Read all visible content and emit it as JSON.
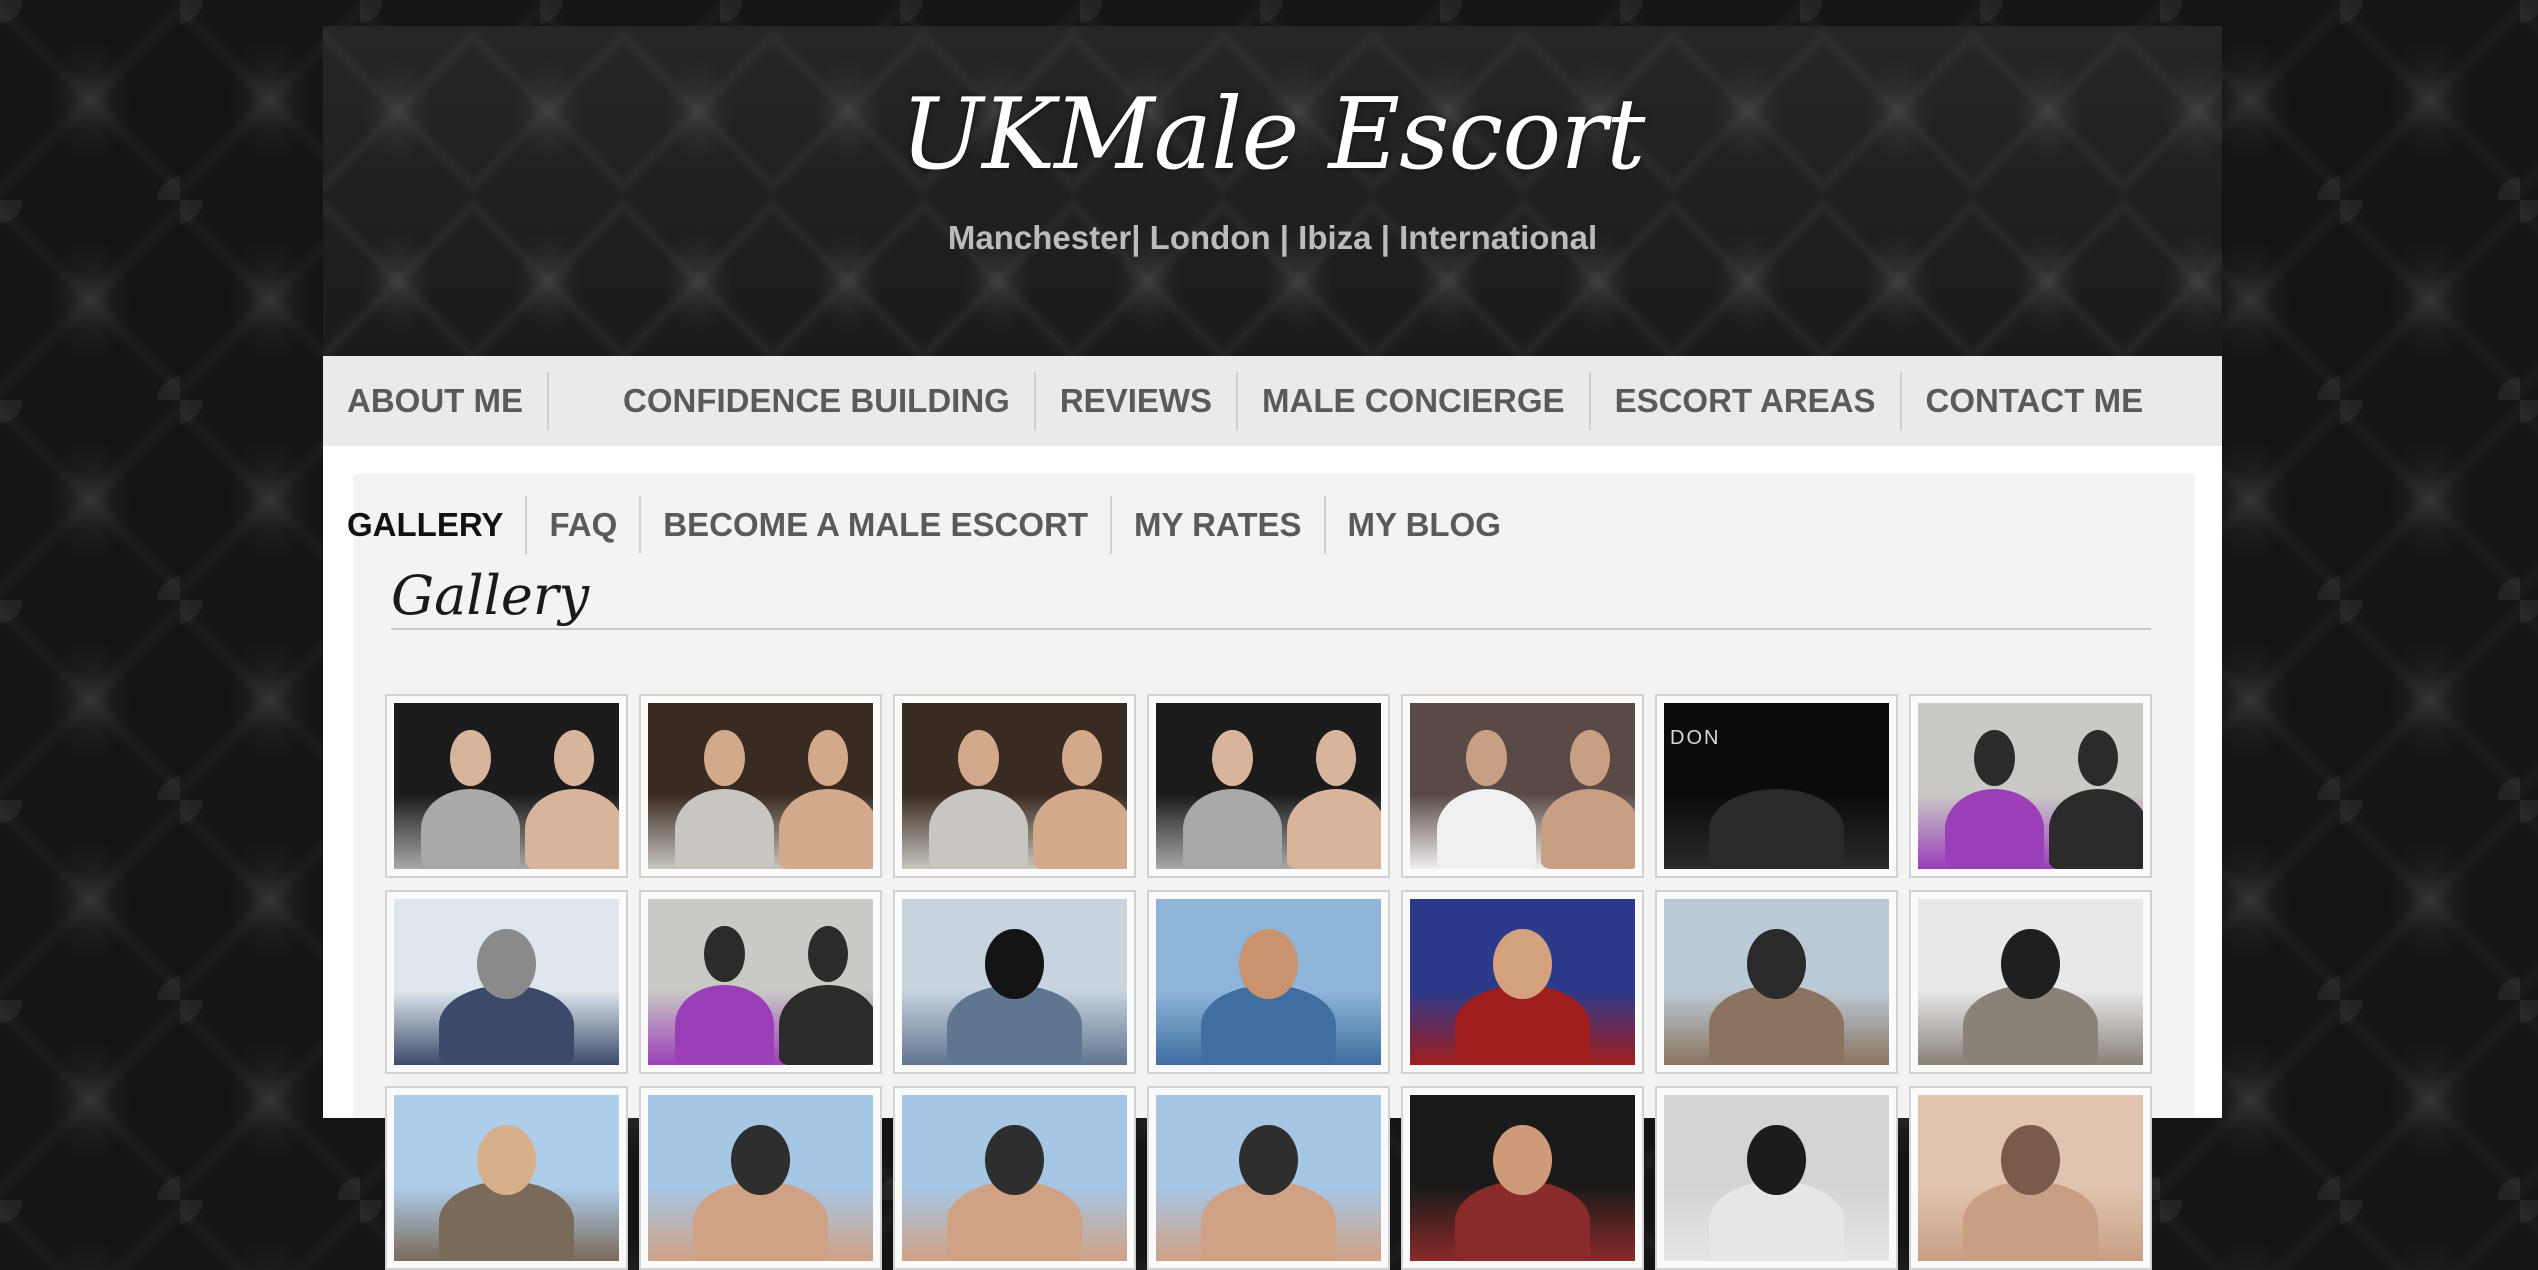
{
  "header": {
    "logo_text": "UKMale Escort",
    "tagline": "Manchester| London | Ibiza | International"
  },
  "nav_primary": [
    {
      "label": "ABOUT ME"
    },
    {
      "label": ""
    },
    {
      "label": "CONFIDENCE BUILDING"
    },
    {
      "label": "REVIEWS"
    },
    {
      "label": "MALE CONCIERGE"
    },
    {
      "label": "ESCORT AREAS"
    },
    {
      "label": "CONTACT ME"
    }
  ],
  "nav_secondary": [
    {
      "label": "GALLERY",
      "active": true
    },
    {
      "label": "FAQ"
    },
    {
      "label": "BECOME A MALE ESCORT"
    },
    {
      "label": "MY RATES"
    },
    {
      "label": "MY BLOG"
    }
  ],
  "page": {
    "title": "Gallery"
  },
  "gallery": {
    "thumbnail_scenes": [
      "couple-night",
      "two-men-party",
      "two-men-party",
      "couple-night",
      "friends-hug",
      "london-night",
      "couple-purple-dress",
      "street-crowd",
      "couple-purple-dress",
      "lake-silhouette",
      "boat-sunbathe",
      "selfie-boat",
      "selfie-city",
      "selfie-snow",
      "beach",
      "sky-portrait",
      "sky-portrait",
      "sky-portrait",
      "dark-portrait",
      "sunglasses-portrait",
      "closeup"
    ],
    "overlay_text": {
      "london-night": "DON"
    },
    "colors": {
      "couple-night": [
        "#1b1b1b",
        "#a9a9a9",
        "#d8b59a"
      ],
      "two-men-party": [
        "#3a2b22",
        "#c9c6c1",
        "#d2a98a"
      ],
      "couple-purple-dress": [
        "#c9c9c5",
        "#9a3fb8",
        "#2b2b2b"
      ],
      "friends-hug": [
        "#5a4a45",
        "#f0f0f0",
        "#c99f84"
      ],
      "london-night": [
        "#0b0b0b",
        "#2a2a2a",
        "#9a9a9a"
      ],
      "street-crowd": [
        "#dfe7ee",
        "#3b4a6a",
        "#8a8a8a"
      ],
      "lake-silhouette": [
        "#c7d3df",
        "#5f7690",
        "#141414"
      ],
      "boat-sunbathe": [
        "#8fb5d9",
        "#3e6fa0",
        "#c8936e"
      ],
      "selfie-boat": [
        "#2c3a8a",
        "#a01e1e",
        "#d4a27f"
      ],
      "selfie-city": [
        "#bcc9d6",
        "#8a7460",
        "#2a2a2a"
      ],
      "selfie-snow": [
        "#e8e8e8",
        "#8a8178",
        "#1f1f1f"
      ],
      "beach": [
        "#aecdea",
        "#7a6a5a",
        "#d6b08a"
      ],
      "sky-portrait": [
        "#a6c6e6",
        "#cfa286",
        "#2e2e2e"
      ],
      "dark-portrait": [
        "#1a1a1a",
        "#8a2a2a",
        "#cf9a7a"
      ],
      "sunglasses-portrait": [
        "#d4d4d4",
        "#e6e6e6",
        "#1c1c1c"
      ],
      "closeup": [
        "#e0c4b0",
        "#c99f84",
        "#7a5a4a"
      ]
    }
  }
}
